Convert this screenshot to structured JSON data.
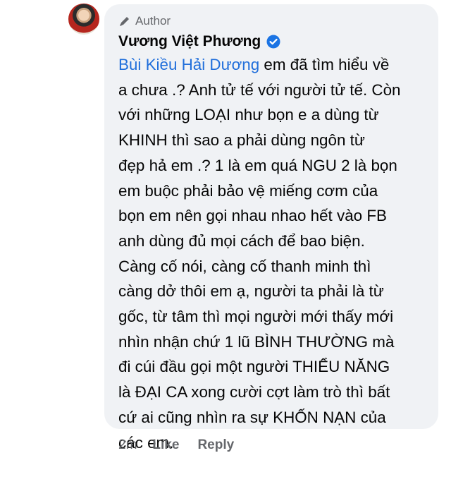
{
  "comment": {
    "badge_label": "Author",
    "author_name": "Vương Việt Phương",
    "mention": "Bùi Kiều Hải Dương",
    "first_line_rest": " em đã tìm hiểu về",
    "lines": [
      "a chưa .? Anh tử tế với người tử tế. Còn",
      "với những LOẠI như bọn e a dùng từ",
      "KHINH thì sao a phải dùng ngôn từ",
      "đẹp hả em .? 1 là em quá NGU 2 là bọn",
      "em buộc phải bảo vệ miếng cơm của",
      "bọn em nên gọi nhau nhao hết vào FB",
      "anh dùng đủ mọi cách để bao biện.",
      "Càng cố nói, càng cố thanh minh thì",
      "càng dở thôi em ạ, người ta phải là từ",
      "gốc, từ tâm thì mọi người mới thấy mới",
      "nhìn nhận chứ 1 lũ BÌNH THƯỜNG mà",
      "đi cúi đầu gọi một người THIỂU NĂNG",
      "là ĐẠI CA xong cười cợt làm trò thì bất",
      "cứ ai cũng nhìn ra sự KHỐN NẠN của",
      "các em."
    ],
    "time": "2m",
    "like_label": "Like",
    "reply_label": "Reply"
  },
  "icons": {
    "badge": "pencil-icon",
    "verified": "verified-check-icon",
    "accent_color": "#216fdb",
    "verified_color": "#1b74e4"
  }
}
